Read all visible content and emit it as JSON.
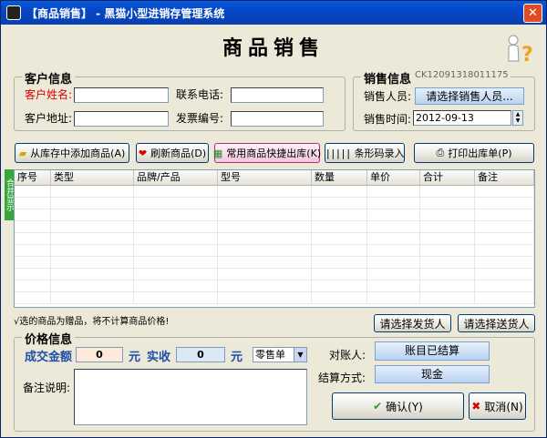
{
  "window": {
    "title": "【商品销售】 - 黑猫小型进销存管理系统",
    "close_glyph": "✕"
  },
  "page": {
    "title": "商品销售",
    "help_icon": "help-figure-icon"
  },
  "customer": {
    "group_title": "客户信息",
    "name_label": "客户姓名:",
    "phone_label": "联系电话:",
    "address_label": "客户地址:",
    "invoice_label": "发票编号:",
    "name_value": "",
    "phone_value": "",
    "address_value": "",
    "invoice_value": ""
  },
  "sale": {
    "group_title": "销售信息",
    "order_no": "CK12091318011175",
    "salesperson_label": "销售人员:",
    "salesperson_value": "请选择销售人员...",
    "time_label": "销售时间:",
    "time_value": "2012-09-13"
  },
  "toolbar": {
    "add_from_stock": "从库存中添加商品(A)",
    "refresh": "刷新商品(D)",
    "quick_out": "常用商品快捷出库(K)",
    "barcode": "条形码录入",
    "print": "打印出库单(P)"
  },
  "grid": {
    "columns": [
      "序号",
      "类型",
      "品牌/产品",
      "型号",
      "数量",
      "单价",
      "合计",
      "备注"
    ],
    "rows": []
  },
  "side_tab": "合并显示",
  "note": "√选的商品为赠品，将不计算商品价格!",
  "buttons": {
    "choose_shipper": "请选择发货人",
    "choose_deliverer": "请选择送货人"
  },
  "price": {
    "group_title": "价格信息",
    "total_label": "成交金额",
    "total_value": "0",
    "unit": "元",
    "received_label": "实收",
    "received_value": "0",
    "received_unit": "元",
    "sale_type": "零售单",
    "remark_label": "备注说明:",
    "remark_value": "",
    "account_label": "对账人:",
    "account_value": "账目已结算",
    "settle_label": "结算方式:",
    "settle_value": "现金",
    "confirm": "确认(Y)",
    "cancel": "取消(N)"
  },
  "colors": {
    "title_bar": "#0447c9",
    "required": "#dd0000",
    "label_blue": "#1f4fa8",
    "total_bg": "#fde9d9",
    "received_bg": "#dbe9f7"
  }
}
